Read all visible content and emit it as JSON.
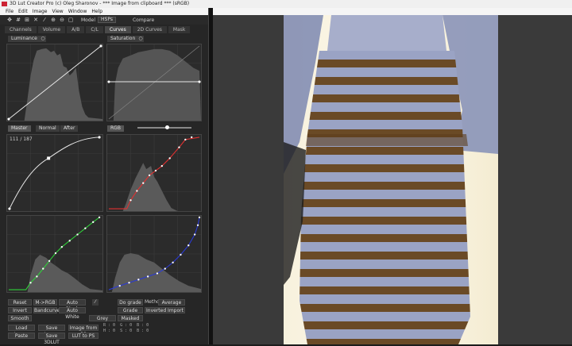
{
  "window": {
    "title": "3D Lut Creator  Pro (c) Oleg Sharonov - *** Image from clipboard *** (sRGB)"
  },
  "menu": [
    "File",
    "Edit",
    "Image",
    "View",
    "Window",
    "Help"
  ],
  "toolbar": {
    "model_label": "Model",
    "model_value": "HSPs",
    "compare_label": "Compare",
    "icons": [
      "move-icon",
      "grid-icon",
      "grid-icon",
      "close-icon",
      "eyedropper-icon",
      "zoom-in-icon",
      "zoom-out-icon",
      "fit-icon"
    ]
  },
  "tabs": [
    "Channels",
    "Volume",
    "A/B",
    "C/L",
    "Curves",
    "2D Curves",
    "Mask"
  ],
  "active_tab": "Curves",
  "top_graphs": {
    "left_label": "Luminance",
    "right_label": "Saturation"
  },
  "curves_header": {
    "master_label": "Master",
    "before_label": "Normal",
    "after_label": "After",
    "rgb_label": "RGB",
    "slider_value": 0.55,
    "readout": "111 / 187"
  },
  "buttons": {
    "reset": "Reset",
    "invert": "Invert",
    "smooth": "Smooth",
    "m_hkgb": "M->RGB",
    "bandcurve": "Bandcurve",
    "auto_black": "Auto Black",
    "auto_white": "Auto White",
    "dograde": "Do grade",
    "grade": "Grade",
    "masked": "Masked",
    "method_label": "Method",
    "method_value": "Average",
    "inverted_import": "Inverted Import",
    "grey_value": "Grey",
    "load_image": "Load Image",
    "save_image": "Save Image",
    "image_from_ps": "Image from PS",
    "paste": "Paste",
    "save_3dlut": "Save 3DLUT",
    "lut_to_ps": "LUT to PS"
  },
  "pixel_readout": {
    "r": "R : 0  G : 0  B : 0",
    "l": "H : 0  S : 0  B : 0"
  },
  "colors": {
    "red_curve": "#e23030",
    "green_curve": "#2fd13a",
    "blue_curve": "#2a3ad8",
    "white_curve": "#e8e8e8"
  }
}
